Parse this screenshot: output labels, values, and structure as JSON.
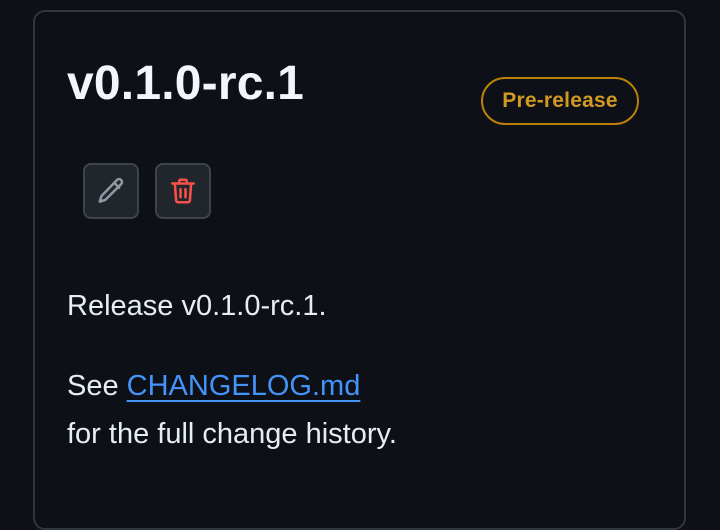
{
  "release": {
    "title": "v0.1.0-rc.1",
    "badge": "Pre-release",
    "actions": {
      "edit_icon": "pencil-icon",
      "delete_icon": "trash-icon"
    },
    "body": {
      "line1": "Release v0.1.0-rc.1.",
      "see": "See",
      "link_text": "CHANGELOG.md",
      "line3": "for the full change history."
    }
  },
  "colors": {
    "background": "#0d1117",
    "border": "#30363d",
    "title": "#f0f6fc",
    "badge": "#d29922",
    "link": "#4493f8",
    "delete": "#f85149"
  }
}
